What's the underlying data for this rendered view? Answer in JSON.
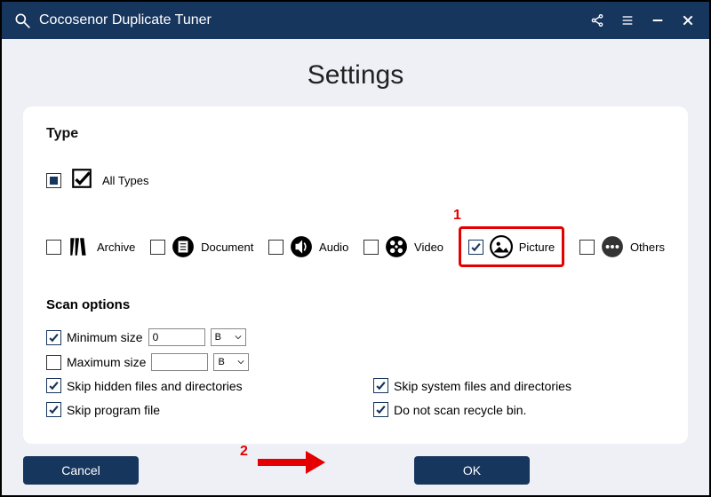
{
  "app": {
    "title": "Cocosenor Duplicate Tuner"
  },
  "page": {
    "title": "Settings"
  },
  "type": {
    "heading": "Type",
    "all_label": "All Types",
    "items": {
      "archive": "Archive",
      "document": "Document",
      "audio": "Audio",
      "video": "Video",
      "picture": "Picture",
      "others": "Others"
    }
  },
  "scan": {
    "heading": "Scan options",
    "min_label": "Minimum size",
    "max_label": "Maximum size",
    "min_value": "0",
    "max_value": "",
    "unit": "B",
    "skip_hidden": "Skip hidden files and directories",
    "skip_system": "Skip system files and directories",
    "skip_program": "Skip program file",
    "skip_recycle": "Do not scan recycle bin."
  },
  "buttons": {
    "cancel": "Cancel",
    "ok": "OK"
  },
  "annotations": {
    "one": "1",
    "two": "2"
  }
}
